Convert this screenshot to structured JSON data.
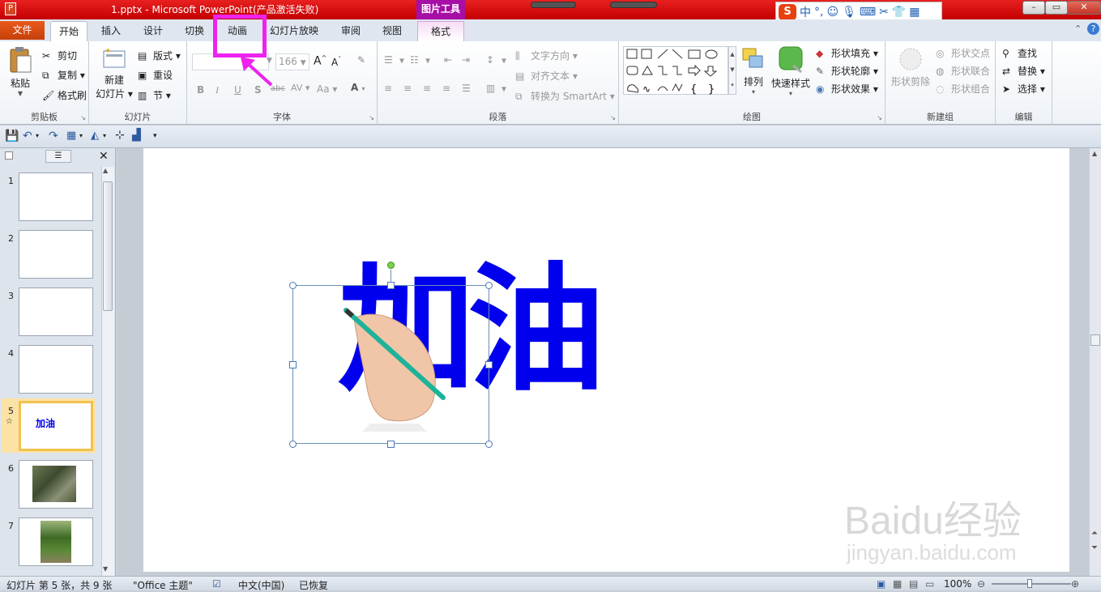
{
  "window": {
    "title": "1.pptx - Microsoft PowerPoint(产品激活失败)",
    "context_tools": "图片工具",
    "minimize": "–",
    "maximize": "▭",
    "close": "✕"
  },
  "ime": {
    "zh": "中",
    "punct": "°,"
  },
  "tabs": {
    "file": "文件",
    "items": [
      "开始",
      "插入",
      "设计",
      "切换",
      "动画",
      "幻灯片放映",
      "审阅",
      "视图"
    ],
    "format": "格式",
    "active": "开始",
    "highlighted": "动画"
  },
  "ribbon": {
    "clipboard": {
      "label": "剪贴板",
      "paste": "粘贴",
      "cut": "剪切",
      "copy": "复制",
      "painter": "格式刷"
    },
    "slides": {
      "label": "幻灯片",
      "new_line1": "新建",
      "new_line2": "幻灯片",
      "layout": "版式",
      "reset": "重设",
      "section": "节"
    },
    "font": {
      "label": "字体",
      "size": "166",
      "bold": "B",
      "italic": "I",
      "underline": "U",
      "shadow": "S",
      "strike": "abc",
      "spacing": "AV",
      "case": "Aa",
      "grow": "A",
      "shrink": "A",
      "color": "A"
    },
    "paragraph": {
      "label": "段落",
      "text_dir": "文字方向",
      "align_text": "对齐文本",
      "smartart": "转换为 SmartArt"
    },
    "drawing": {
      "label": "绘图",
      "arrange": "排列",
      "quick_styles": "快速样式",
      "fill": "形状填充",
      "outline": "形状轮廓",
      "effects": "形状效果"
    },
    "new_group": {
      "label": "新建组",
      "subtract": "形状剪除",
      "intersect": "形状交点",
      "union": "形状联合",
      "combine": "形状组合"
    },
    "editing": {
      "label": "编辑",
      "find": "查找",
      "replace": "替换",
      "select": "选择"
    }
  },
  "slides_panel": {
    "numbers": [
      "1",
      "2",
      "3",
      "4",
      "5",
      "6",
      "7"
    ],
    "selected": "5",
    "thumb5_text": "加油"
  },
  "slide": {
    "text": "加油",
    "text_color": "#0000ee"
  },
  "watermark": {
    "line1": "Baidu经验",
    "line2": "jingyan.baidu.com"
  },
  "status": {
    "slide_info": "幻灯片 第 5 张，共 9 张",
    "theme": "\"Office 主题\"",
    "language": "中文(中国)",
    "recovered": "已恢复",
    "zoom": "100%"
  },
  "colors": {
    "title_bar": "#d20a0a",
    "file_tab": "#d4490f",
    "highlight": "#ee22ee",
    "text_blue": "#0000ee"
  }
}
